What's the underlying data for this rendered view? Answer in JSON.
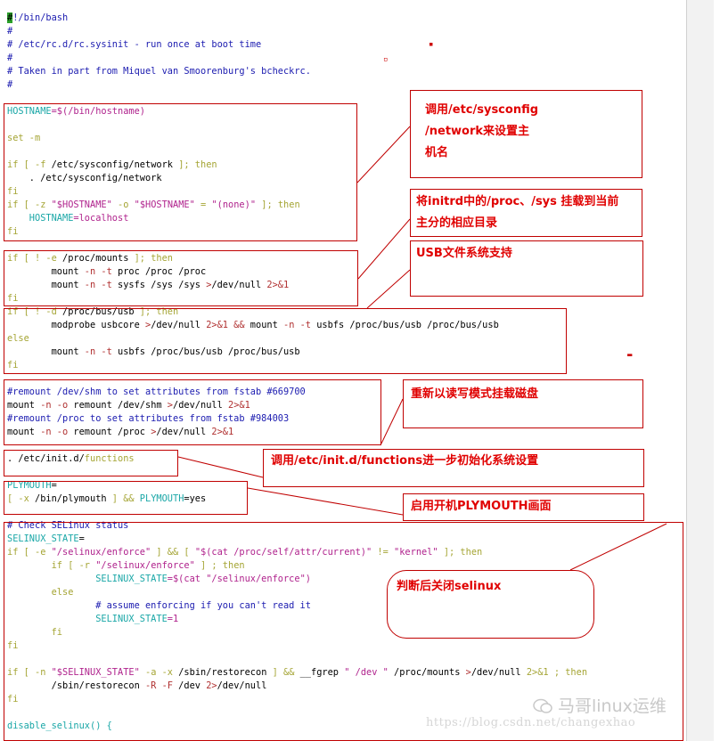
{
  "code_lines": [
    {
      "parts": [
        {
          "t": "#",
          "c": "cursor"
        },
        {
          "t": "!/bin/bash",
          "c": "c"
        }
      ]
    },
    {
      "parts": [
        {
          "t": "#",
          "c": "c"
        }
      ]
    },
    {
      "parts": [
        {
          "t": "# /etc/rc.d/rc.sysinit - run once at boot time",
          "c": "c"
        }
      ]
    },
    {
      "parts": [
        {
          "t": "#",
          "c": "c"
        }
      ]
    },
    {
      "parts": [
        {
          "t": "# Taken in part from Miquel van Smoorenburg's bcheckrc.",
          "c": "c"
        }
      ]
    },
    {
      "parts": [
        {
          "t": "#",
          "c": "c"
        }
      ]
    },
    {
      "parts": [
        {
          "t": "",
          "c": ""
        }
      ]
    },
    {
      "parts": [
        {
          "t": "HOSTNAME",
          "c": "v"
        },
        {
          "t": "=$(/bin/hostname)",
          "c": "s"
        }
      ]
    },
    {
      "parts": [
        {
          "t": "",
          "c": ""
        }
      ]
    },
    {
      "parts": [
        {
          "t": "set -m",
          "c": "k"
        }
      ]
    },
    {
      "parts": [
        {
          "t": "",
          "c": ""
        }
      ]
    },
    {
      "parts": [
        {
          "t": "if [ -f ",
          "c": "k"
        },
        {
          "t": "/etc/sysconfig/network ",
          "c": ""
        },
        {
          "t": "]; then",
          "c": "k"
        }
      ]
    },
    {
      "parts": [
        {
          "t": "    . /etc/sysconfig/network",
          "c": ""
        }
      ]
    },
    {
      "parts": [
        {
          "t": "fi",
          "c": "k"
        }
      ]
    },
    {
      "parts": [
        {
          "t": "if [ -z ",
          "c": "k"
        },
        {
          "t": "\"$HOSTNAME\"",
          "c": "s"
        },
        {
          "t": " -o ",
          "c": "k"
        },
        {
          "t": "\"$HOSTNAME\"",
          "c": "s"
        },
        {
          "t": " = ",
          "c": "k"
        },
        {
          "t": "\"(none)\"",
          "c": "s"
        },
        {
          "t": " ]; then",
          "c": "k"
        }
      ]
    },
    {
      "parts": [
        {
          "t": "    HOSTNAME",
          "c": "v"
        },
        {
          "t": "=localhost",
          "c": "s"
        }
      ]
    },
    {
      "parts": [
        {
          "t": "fi",
          "c": "k"
        }
      ]
    },
    {
      "parts": [
        {
          "t": "",
          "c": ""
        }
      ]
    },
    {
      "parts": [
        {
          "t": "if [ ! -e ",
          "c": "k"
        },
        {
          "t": "/proc/mounts ",
          "c": ""
        },
        {
          "t": "]; then",
          "c": "k"
        }
      ]
    },
    {
      "parts": [
        {
          "t": "        mount ",
          "c": ""
        },
        {
          "t": "-n -t",
          "c": "r"
        },
        {
          "t": " proc /proc /proc",
          "c": ""
        }
      ]
    },
    {
      "parts": [
        {
          "t": "        mount ",
          "c": ""
        },
        {
          "t": "-n -t",
          "c": "r"
        },
        {
          "t": " sysfs /sys /sys ",
          "c": ""
        },
        {
          "t": ">",
          "c": "r"
        },
        {
          "t": "/dev/null ",
          "c": ""
        },
        {
          "t": "2>&1",
          "c": "r"
        }
      ]
    },
    {
      "parts": [
        {
          "t": "fi",
          "c": "k"
        }
      ]
    },
    {
      "parts": [
        {
          "t": "if [ ! -d ",
          "c": "k"
        },
        {
          "t": "/proc/bus/usb ",
          "c": ""
        },
        {
          "t": "]; then",
          "c": "k"
        }
      ]
    },
    {
      "parts": [
        {
          "t": "        modprobe usbcore ",
          "c": ""
        },
        {
          "t": ">",
          "c": "r"
        },
        {
          "t": "/dev/null ",
          "c": ""
        },
        {
          "t": "2>&1 && ",
          "c": "r"
        },
        {
          "t": "mount ",
          "c": ""
        },
        {
          "t": "-n -t",
          "c": "r"
        },
        {
          "t": " usbfs /proc/bus/usb /proc/bus/usb",
          "c": ""
        }
      ]
    },
    {
      "parts": [
        {
          "t": "else",
          "c": "k"
        }
      ]
    },
    {
      "parts": [
        {
          "t": "        mount ",
          "c": ""
        },
        {
          "t": "-n -t",
          "c": "r"
        },
        {
          "t": " usbfs /proc/bus/usb /proc/bus/usb",
          "c": ""
        }
      ]
    },
    {
      "parts": [
        {
          "t": "fi",
          "c": "k"
        }
      ]
    },
    {
      "parts": [
        {
          "t": "",
          "c": ""
        }
      ]
    },
    {
      "parts": [
        {
          "t": "#remount /dev/shm to set attributes from fstab #669700",
          "c": "c"
        }
      ]
    },
    {
      "parts": [
        {
          "t": "mount ",
          "c": ""
        },
        {
          "t": "-n -o",
          "c": "r"
        },
        {
          "t": " remount /dev/shm ",
          "c": ""
        },
        {
          "t": ">",
          "c": "r"
        },
        {
          "t": "/dev/null ",
          "c": ""
        },
        {
          "t": "2>&1",
          "c": "r"
        }
      ]
    },
    {
      "parts": [
        {
          "t": "#remount /proc to set attributes from fstab #984003",
          "c": "c"
        }
      ]
    },
    {
      "parts": [
        {
          "t": "mount ",
          "c": ""
        },
        {
          "t": "-n -o",
          "c": "r"
        },
        {
          "t": " remount /proc ",
          "c": ""
        },
        {
          "t": ">",
          "c": "r"
        },
        {
          "t": "/dev/null ",
          "c": ""
        },
        {
          "t": "2>&1",
          "c": "r"
        }
      ]
    },
    {
      "parts": [
        {
          "t": "",
          "c": ""
        }
      ]
    },
    {
      "parts": [
        {
          "t": ". /etc/init.d/",
          "c": ""
        },
        {
          "t": "functions",
          "c": "k"
        }
      ]
    },
    {
      "parts": [
        {
          "t": "",
          "c": ""
        }
      ]
    },
    {
      "parts": [
        {
          "t": "PLYMOUTH",
          "c": "v"
        },
        {
          "t": "=",
          "c": ""
        }
      ]
    },
    {
      "parts": [
        {
          "t": "[ -x ",
          "c": "k"
        },
        {
          "t": "/bin/plymouth ",
          "c": ""
        },
        {
          "t": "] && ",
          "c": "k"
        },
        {
          "t": "PLYMOUTH",
          "c": "v"
        },
        {
          "t": "=yes",
          "c": ""
        }
      ]
    },
    {
      "parts": [
        {
          "t": "",
          "c": ""
        }
      ]
    },
    {
      "parts": [
        {
          "t": "# Check SELinux status",
          "c": "c"
        }
      ]
    },
    {
      "parts": [
        {
          "t": "SELINUX_STATE",
          "c": "v"
        },
        {
          "t": "=",
          "c": ""
        }
      ]
    },
    {
      "parts": [
        {
          "t": "if [ -e ",
          "c": "k"
        },
        {
          "t": "\"/selinux/enforce\"",
          "c": "s"
        },
        {
          "t": " ] && [ ",
          "c": "k"
        },
        {
          "t": "\"$(cat /proc/self/attr/current)\"",
          "c": "s"
        },
        {
          "t": " != ",
          "c": "k"
        },
        {
          "t": "\"kernel\"",
          "c": "s"
        },
        {
          "t": " ]; then",
          "c": "k"
        }
      ]
    },
    {
      "parts": [
        {
          "t": "        if [ -r ",
          "c": "k"
        },
        {
          "t": "\"/selinux/enforce\"",
          "c": "s"
        },
        {
          "t": " ] ; then",
          "c": "k"
        }
      ]
    },
    {
      "parts": [
        {
          "t": "                SELINUX_STATE",
          "c": "v"
        },
        {
          "t": "=$(cat ",
          "c": "s"
        },
        {
          "t": "\"/selinux/enforce\"",
          "c": "s"
        },
        {
          "t": ")",
          "c": "s"
        }
      ]
    },
    {
      "parts": [
        {
          "t": "        else",
          "c": "k"
        }
      ]
    },
    {
      "parts": [
        {
          "t": "                # assume enforcing if you can't read it",
          "c": "c"
        }
      ]
    },
    {
      "parts": [
        {
          "t": "                SELINUX_STATE",
          "c": "v"
        },
        {
          "t": "=1",
          "c": "s"
        }
      ]
    },
    {
      "parts": [
        {
          "t": "        fi",
          "c": "k"
        }
      ]
    },
    {
      "parts": [
        {
          "t": "fi",
          "c": "k"
        }
      ]
    },
    {
      "parts": [
        {
          "t": "",
          "c": ""
        }
      ]
    },
    {
      "parts": [
        {
          "t": "if [ -n ",
          "c": "k"
        },
        {
          "t": "\"$SELINUX_STATE\"",
          "c": "s"
        },
        {
          "t": " -a -x ",
          "c": "k"
        },
        {
          "t": "/sbin/restorecon ",
          "c": ""
        },
        {
          "t": "] && ",
          "c": "k"
        },
        {
          "t": "__fgrep ",
          "c": ""
        },
        {
          "t": "\" /dev \"",
          "c": "s"
        },
        {
          "t": " /proc/mounts ",
          "c": ""
        },
        {
          "t": ">",
          "c": "r"
        },
        {
          "t": "/dev/null ",
          "c": ""
        },
        {
          "t": "2>&1 ; then",
          "c": "k"
        }
      ]
    },
    {
      "parts": [
        {
          "t": "        /sbin/restorecon ",
          "c": ""
        },
        {
          "t": "-R -F",
          "c": "r"
        },
        {
          "t": " /dev ",
          "c": ""
        },
        {
          "t": "2>",
          "c": "r"
        },
        {
          "t": "/dev/null",
          "c": ""
        }
      ]
    },
    {
      "parts": [
        {
          "t": "fi",
          "c": "k"
        }
      ]
    },
    {
      "parts": [
        {
          "t": "",
          "c": ""
        }
      ]
    },
    {
      "parts": [
        {
          "t": "disable_selinux() {",
          "c": "v"
        }
      ]
    }
  ],
  "notes": {
    "hostname": [
      "调用/etc/sysconfig",
      "/network来设置主",
      "机名"
    ],
    "mount_proc_sys": [
      "将initrd中的/proc、/sys 挂载到当前",
      "主分的相应目录"
    ],
    "usb": [
      "USB文件系统支持"
    ],
    "remount": [
      "重新以读写模式挂载磁盘"
    ],
    "functions": [
      "调用/etc/init.d/functions进一步初始化系统设置"
    ],
    "plymouth": [
      "启用开机PLYMOUTH画面"
    ],
    "selinux": [
      "判断后关闭selinux"
    ]
  },
  "watermark": {
    "name": "马哥linux运维",
    "url": "https://blog.csdn.net/changexhao"
  }
}
